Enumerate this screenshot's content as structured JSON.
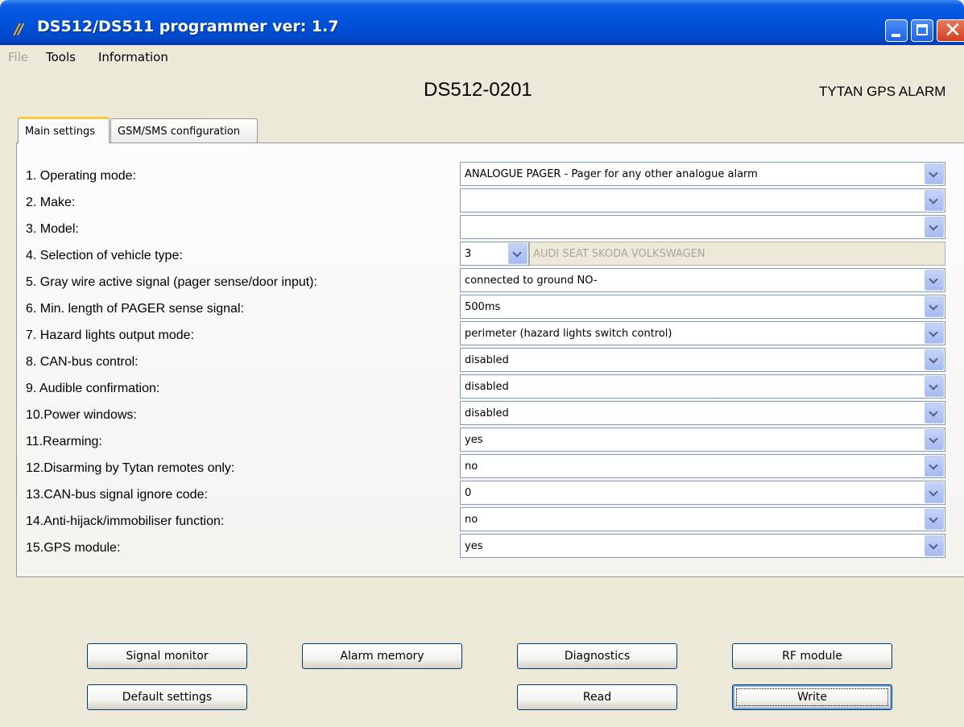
{
  "window": {
    "title": "DS512/DS511 programmer ver:  1.7",
    "app_icon_text": "//"
  },
  "menu": {
    "file": "File",
    "tools": "Tools",
    "information": "Information"
  },
  "header": {
    "device": "DS512-0201",
    "brand": "TYTAN GPS  ALARM"
  },
  "tabs": [
    {
      "label": "Main settings",
      "active": true
    },
    {
      "label": "GSM/SMS configuration",
      "active": false
    }
  ],
  "settings": [
    {
      "label": "1.  Operating mode:",
      "value": "ANALOGUE PAGER - Pager for any other analogue alarm"
    },
    {
      "label": "2.  Make:",
      "value": ""
    },
    {
      "label": "3.  Model:",
      "value": ""
    },
    {
      "label": "4.  Selection of vehicle type:",
      "value": "3",
      "extra": "AUDI SEAT SKODA VOLKSWAGEN"
    },
    {
      "label": "5.  Gray wire active signal (pager sense/door input):",
      "value": "connected to ground NO-"
    },
    {
      "label": "6.  Min. length of PAGER sense signal:",
      "value": "500ms"
    },
    {
      "label": "7.  Hazard lights output mode:",
      "value": "perimeter (hazard lights switch control)"
    },
    {
      "label": "8.  CAN-bus control:",
      "value": "disabled"
    },
    {
      "label": "9.  Audible confirmation:",
      "value": "disabled"
    },
    {
      "label": "10.Power windows:",
      "value": "disabled"
    },
    {
      "label": "11.Rearming:",
      "value": "yes"
    },
    {
      "label": "12.Disarming by Tytan remotes only:",
      "value": "no"
    },
    {
      "label": "13.CAN-bus signal ignore code:",
      "value": "0"
    },
    {
      "label": "14.Anti-hijack/immobiliser function:",
      "value": "no"
    },
    {
      "label": "15.GPS module:",
      "value": "yes"
    }
  ],
  "buttons": {
    "signal_monitor": "Signal monitor",
    "alarm_memory": "Alarm memory",
    "diagnostics": "Diagnostics",
    "rf_module": "RF module",
    "default_settings": "Default settings",
    "read": "Read",
    "write": "Write"
  }
}
